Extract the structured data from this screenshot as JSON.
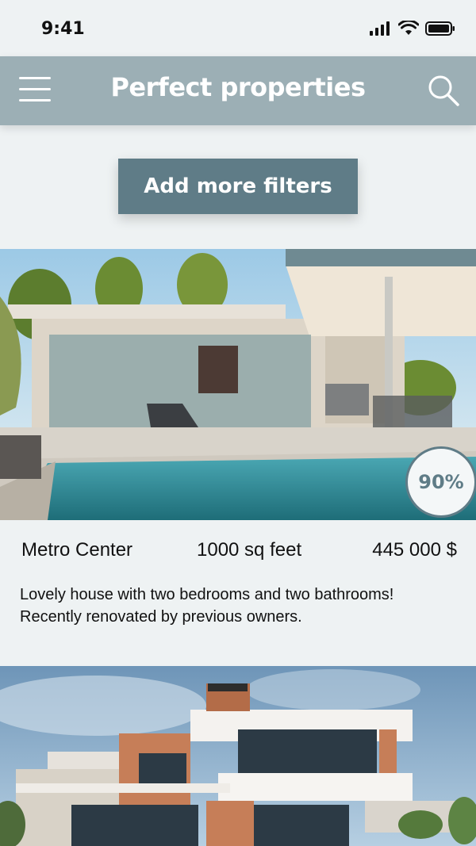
{
  "status_bar": {
    "time": "9:41"
  },
  "header": {
    "title": "Perfect properties",
    "menu_icon": "hamburger-menu-icon",
    "search_icon": "search-icon"
  },
  "filters": {
    "button_label": "Add more filters"
  },
  "colors": {
    "header_bg": "#9cafb5",
    "accent": "#5f7c87",
    "page_bg": "#eef2f3"
  },
  "listings": [
    {
      "location": "Metro Center",
      "area": "1000 sq feet",
      "price": "445 000 $",
      "description_line1": "Lovely house with two bedrooms and two bathrooms!",
      "description_line2": "Recently renovated by previous owners.",
      "match_score": "90%"
    }
  ]
}
